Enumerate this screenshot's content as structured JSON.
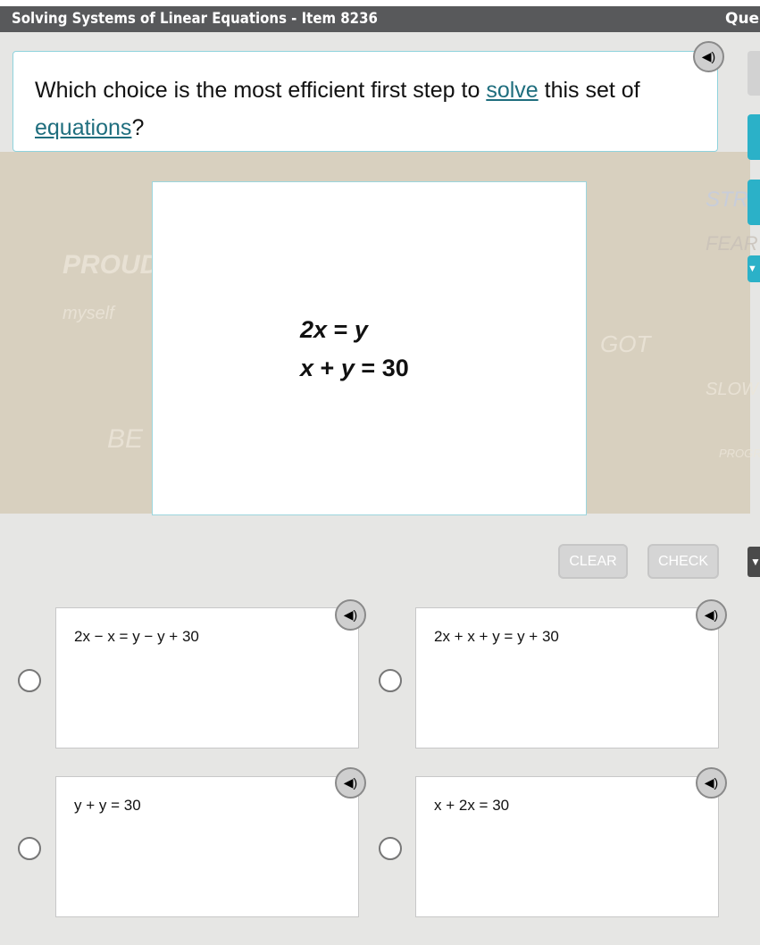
{
  "header": {
    "title": "Solving Systems of Linear Equations - Item 8236",
    "right_label": "Ques"
  },
  "prompt": {
    "before": "Which choice is the most efficient first step to ",
    "link1": "solve",
    "middle": " this set of ",
    "link2": "equations",
    "after": "?"
  },
  "equations": {
    "line1": {
      "left": "2x",
      "op": "=",
      "right": "y"
    },
    "line2": {
      "a": "x",
      "plus": "+",
      "b": "y",
      "op": "=",
      "c": "30"
    }
  },
  "background_text": [
    "PROUD",
    "myself",
    "BE",
    "GOT",
    "STRO",
    "FEAR",
    "SLOW",
    "PROGR"
  ],
  "buttons": {
    "clear": "CLEAR",
    "check": "CHECK"
  },
  "choices": [
    {
      "label": "2x − x = y − y + 30",
      "selected": false
    },
    {
      "label": "2x + x + y = y + 30",
      "selected": false
    },
    {
      "label": "y + y = 30",
      "selected": false
    },
    {
      "label": "x + 2x = 30",
      "selected": false
    }
  ],
  "colors": {
    "header": "#58595b",
    "accent": "#2bb1c8",
    "link": "#1f6e7e"
  },
  "icons": {
    "audio": "speaker-icon",
    "dropdown": "triangle-down-icon"
  }
}
